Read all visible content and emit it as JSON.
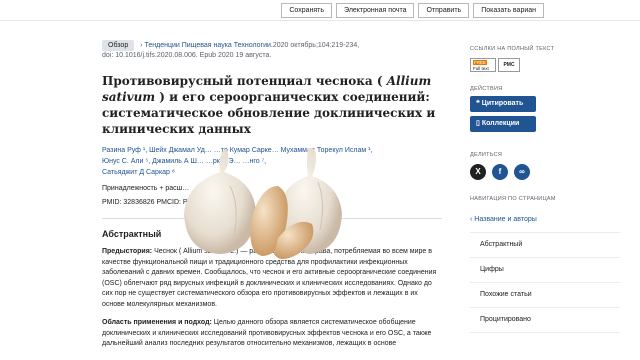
{
  "toolbar": {
    "save": "Сохранять",
    "email": "Электронная почта",
    "send": "Отправить",
    "display": "Показать вариан"
  },
  "header": {
    "badge": "Обзор",
    "journal": "Тенденции Пищевая наука Технологии.",
    "citation": "2020 октябрь;104:219-234,",
    "doi": "doi: 10.1016/j.tifs.2020.08.006. Epub 2020 19 августа."
  },
  "article": {
    "title_a": "Противовирусный потенциал чеснока (",
    "title_species": "Allium sativum",
    "title_b": ") и его сероорганических соединений: систематическое обновление доклинических и клинических данных",
    "authors_line1": "Разина Руф ¹, Шейх Джамал Уд…  …то Кумар Сарке…  Мухаммад Торекул Ислам ¹,",
    "authors_line2": "Юнус С. Али ⁵, Джамиль А Ш…  …рк ⁶, Э…  …нго ⁷,",
    "authors_line3": "Сатьяджит Д Саркар ⁸",
    "affiliations": "Принадлежность  + расш…",
    "ids": "PMID: 32836826   PMCID: P…",
    "abstract_heading": "Абстрактный",
    "background_label": "Предыстория:",
    "background_text": " Чеснок ( Allium sativum L.) — распространенная трава, потребляемая во всем мире в качестве функциональной пищи и традиционного средства для профилактики инфекционных заболеваний с давних времен. Сообщалось, что чеснок и его активные сероорганические соединения (OSC) облегчают ряд вирусных инфекций в доклинических и клинических исследованиях. Однако до сих пор не существует систематического обзора его противовирусных эффектов и лежащих в их основе молекулярных механизмов.",
    "scope_label": "Область применения и подход:",
    "scope_text": " Целью данного обзора является систематическое обобщение доклинических и клинических исследований противовирусных эффектов чеснока и его OSC, а также дальнейший анализ последних результатов относительно механизмов, лежащих в основе"
  },
  "sidebar": {
    "fulltext_label": "ССЫЛКИ НА ПОЛНЫЙ ТЕКСТ",
    "ft_free": "FREE",
    "ft_text": "Full text",
    "pmc": "PMC",
    "actions_label": "ДЕЙСТВИЯ",
    "cite": "Цитировать",
    "collections": "Коллекции",
    "share_label": "ДЕЛИТЬСЯ",
    "nav_label": "НАВИГАЦИЯ ПО СТРАНИЦАМ",
    "nav": [
      "Название и авторы",
      "Абстрактный",
      "Цифры",
      "Похожие статьи",
      "Процитировано"
    ]
  },
  "colors": {
    "accent": "#205493",
    "badge_bg": "#dfe2e6"
  },
  "icons": [
    "quote-icon",
    "bookmark-icon",
    "x-icon",
    "facebook-icon",
    "link-icon",
    "chevron-up-icon",
    "garlic-image"
  ]
}
